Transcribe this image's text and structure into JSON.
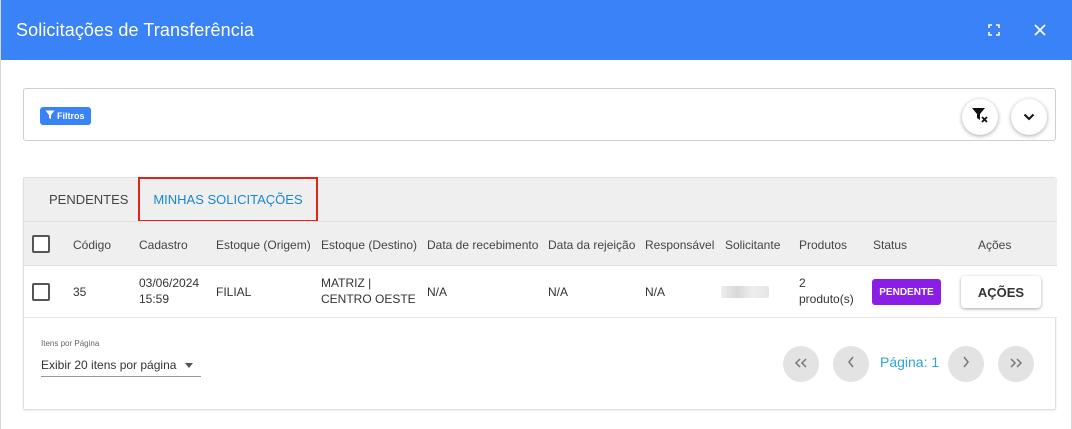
{
  "window": {
    "title": "Solicitações de Transferência"
  },
  "filters": {
    "button_label": "Filtros"
  },
  "tabs": [
    {
      "label": "PENDENTES"
    },
    {
      "label": "MINHAS SOLICITAÇÕES"
    }
  ],
  "table": {
    "columns": [
      "Código",
      "Cadastro",
      "Estoque (Origem)",
      "Estoque (Destino)",
      "Data de recebimento",
      "Data da rejeição",
      "Responsável",
      "Solicitante",
      "Produtos",
      "Status",
      "Ações"
    ],
    "rows": [
      {
        "codigo": "35",
        "cadastro_date": "03/06/2024",
        "cadastro_time": "15:59",
        "origem": "FILIAL",
        "destino_line1": "MATRIZ |",
        "destino_line2": "CENTRO OESTE",
        "data_recebimento": "N/A",
        "data_rejeicao": "N/A",
        "responsavel": "N/A",
        "produtos_line1": "2",
        "produtos_line2": "produto(s)",
        "status": "PENDENTE",
        "acoes": "AÇÕES"
      }
    ]
  },
  "pagination": {
    "per_page_label": "Itens por Página",
    "per_page_value": "Exibir 20 itens por página",
    "page_label": "Página: 1"
  },
  "colors": {
    "primary": "#3a82f7",
    "status_pendente": "#8a1ee6",
    "active_tab_text": "#1a86d0",
    "highlight_border": "#e0231b"
  }
}
